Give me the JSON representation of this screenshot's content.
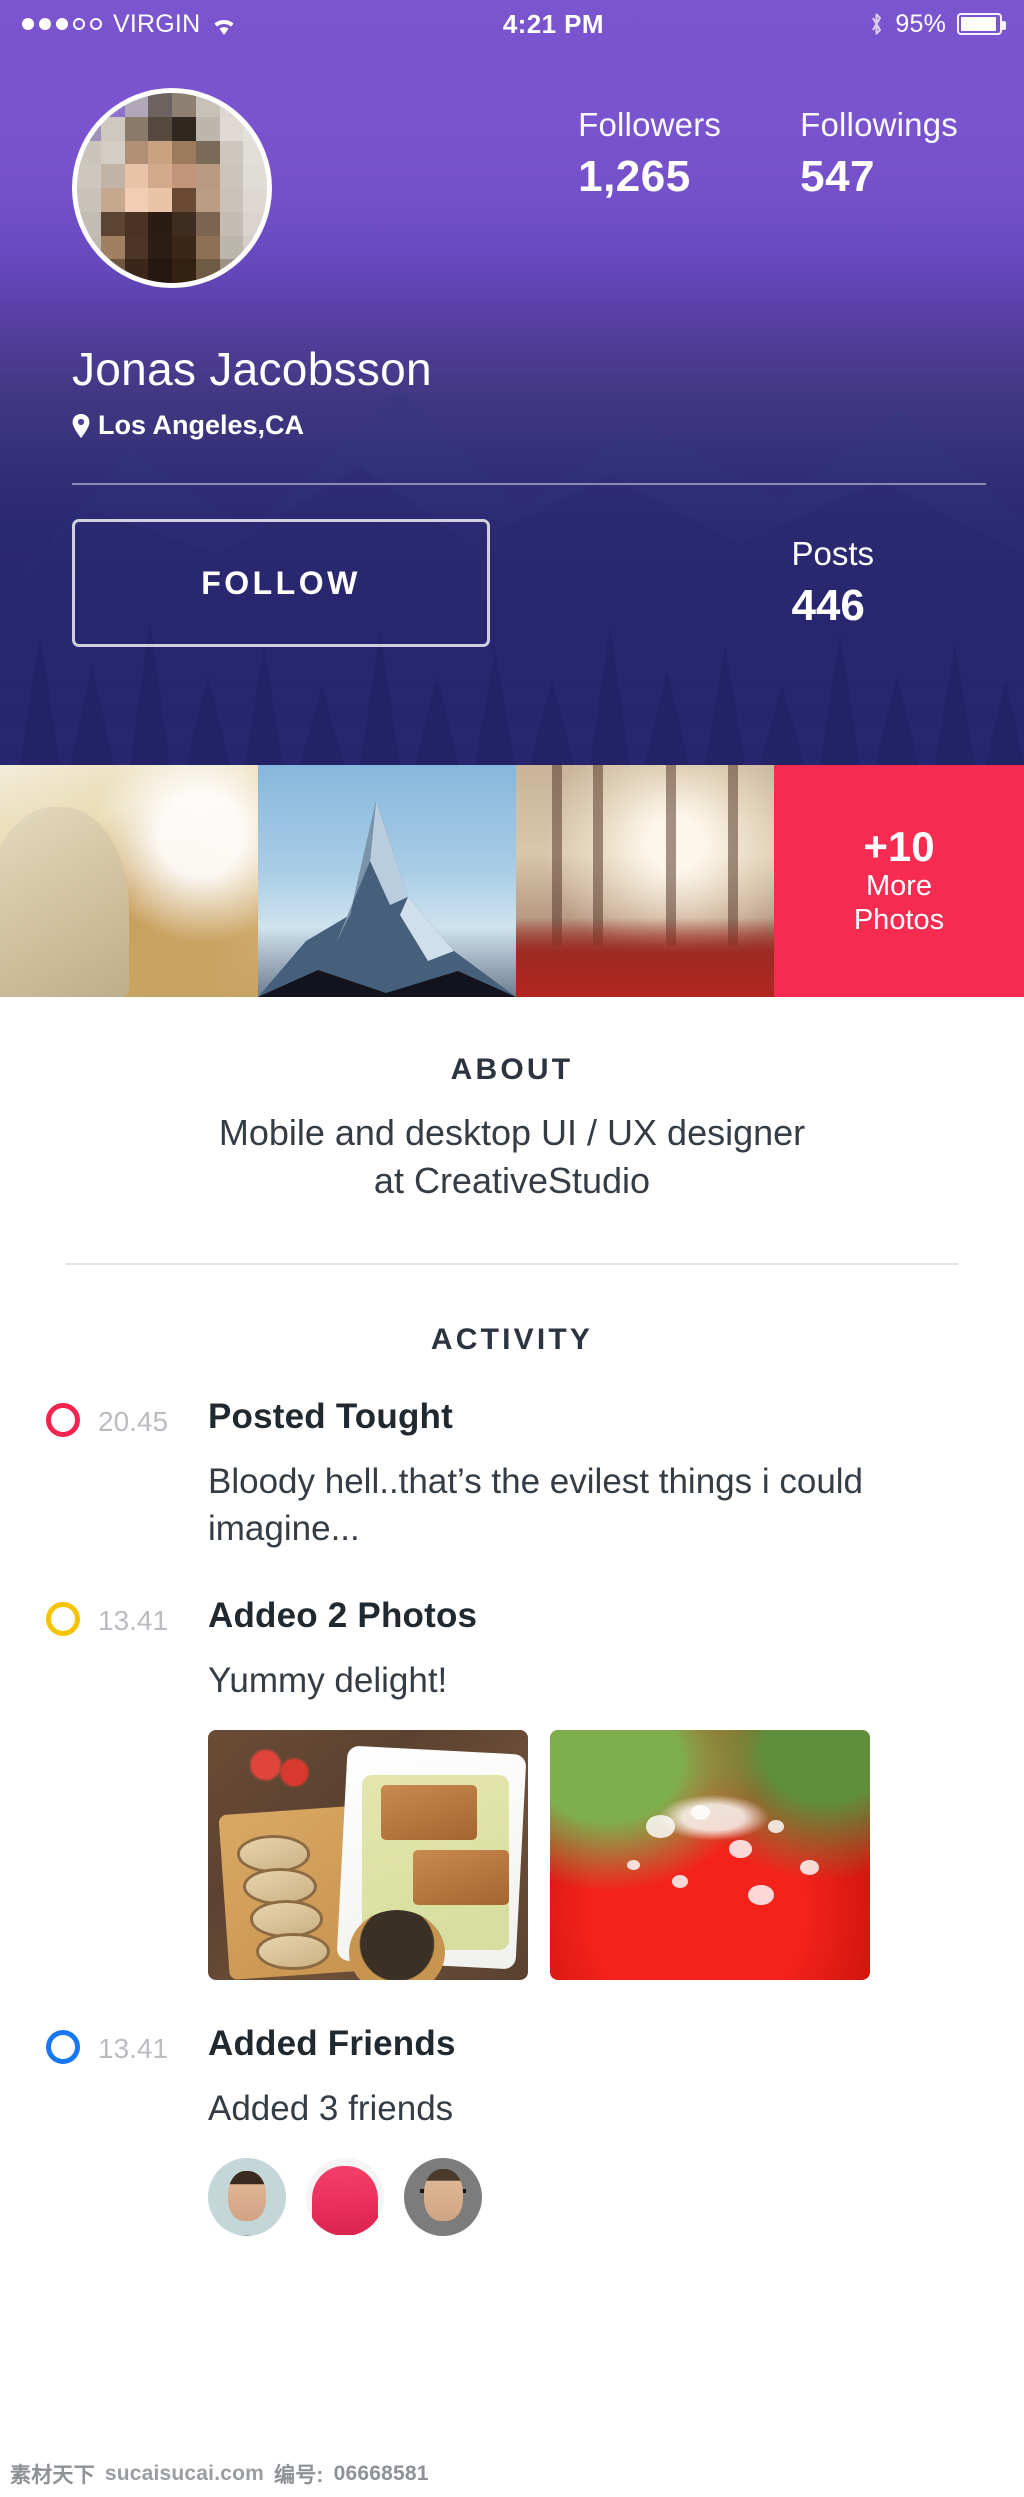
{
  "statusbar": {
    "signal_dots_filled": 3,
    "signal_dots_total": 5,
    "carrier": "VIRGIN",
    "wifi_icon": "wifi-icon",
    "time": "4:21 PM",
    "bluetooth_icon": "bluetooth-icon",
    "battery_percent": "95%",
    "battery_icon": "battery-icon"
  },
  "profile": {
    "avatar_name": "profile-avatar",
    "name": "Jonas Jacobsson",
    "location": "Los Angeles,CA",
    "location_icon": "location-pin-icon",
    "stats": [
      {
        "label": "Followers",
        "value": "1,265"
      },
      {
        "label": "Followings",
        "value": "547"
      }
    ],
    "follow_button": "FOLLOW",
    "posts": {
      "label": "Posts",
      "value": "446"
    }
  },
  "photo_strip": {
    "photos": [
      {
        "alt": "hooded-person-autumn"
      },
      {
        "alt": "snow-mountain-peak"
      },
      {
        "alt": "red-forest-path"
      }
    ],
    "more": {
      "count": "+10",
      "line1": "More",
      "line2": "Photos",
      "bg_color": "#F52B52"
    }
  },
  "about": {
    "heading": "ABOUT",
    "line1": "Mobile and desktop UI / UX designer",
    "line2": "at CreativeStudio"
  },
  "activity": {
    "heading": "ACTIVITY",
    "items": [
      {
        "time": "20.45",
        "title": "Posted Tought",
        "text": "Bloody hell..that’s the evilest things i could imagine...",
        "dot_color": "#F5234F",
        "kind": "text"
      },
      {
        "time": "13.41",
        "title": "Addeo 2 Photos",
        "text": "Yummy delight!",
        "dot_color": "#F5C400",
        "kind": "photos",
        "photos": [
          {
            "alt": "salmon-bread-board"
          },
          {
            "alt": "wet-red-tomato"
          }
        ]
      },
      {
        "time": "13.41",
        "title": "Added Friends",
        "text": "Added 3 friends",
        "dot_color": "#1877F2",
        "kind": "friends",
        "friends": [
          {
            "alt": "friend-bearded-man"
          },
          {
            "alt": "friend-pink-hoodie"
          },
          {
            "alt": "friend-glasses-man"
          }
        ]
      }
    ]
  },
  "watermark": {
    "brand": "素材天下",
    "site": "sucaisucai.com",
    "id_label": "编号:",
    "id_value": "06668581"
  }
}
